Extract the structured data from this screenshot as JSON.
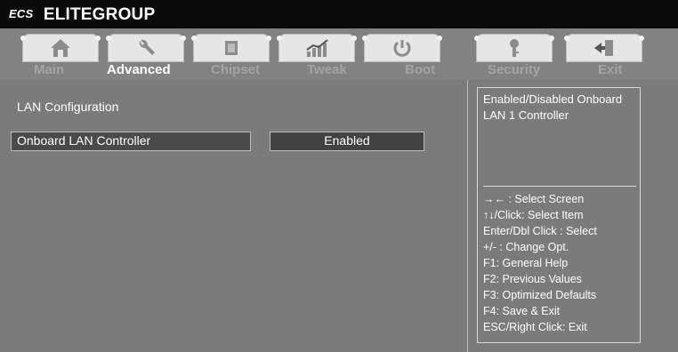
{
  "brand": {
    "logo": "ECS",
    "name": "ELITEGROUP"
  },
  "tabs": [
    {
      "label": "Main",
      "icon": "home-icon",
      "active": false
    },
    {
      "label": "Advanced",
      "icon": "wrench-icon",
      "active": true
    },
    {
      "label": "Chipset",
      "icon": "chip-icon",
      "active": false
    },
    {
      "label": "Tweak",
      "icon": "chart-icon",
      "active": false
    },
    {
      "label": "Boot",
      "icon": "power-icon",
      "active": false
    },
    {
      "label": "Security",
      "icon": "key-icon",
      "active": false
    },
    {
      "label": "Exit",
      "icon": "exit-door-icon",
      "active": false
    }
  ],
  "main": {
    "section_title": "LAN Configuration",
    "setting": {
      "label": "Onboard LAN  Controller",
      "value": "Enabled"
    }
  },
  "help": {
    "description": "Enabled/Disabled Onboard LAN 1 Controller",
    "keys": [
      "→←  : Select Screen",
      "↑↓/Click: Select Item",
      "Enter/Dbl Click : Select",
      "+/- : Change Opt.",
      "F1: General Help",
      "F2: Previous Values",
      "F3: Optimized Defaults",
      "F4: Save & Exit",
      "ESC/Right Click: Exit"
    ]
  },
  "colors": {
    "background": "#7b7b7b",
    "topbar": "#0a0a0a",
    "active_tab": "#ffffff",
    "inactive_tab": "#a3a3a3"
  }
}
